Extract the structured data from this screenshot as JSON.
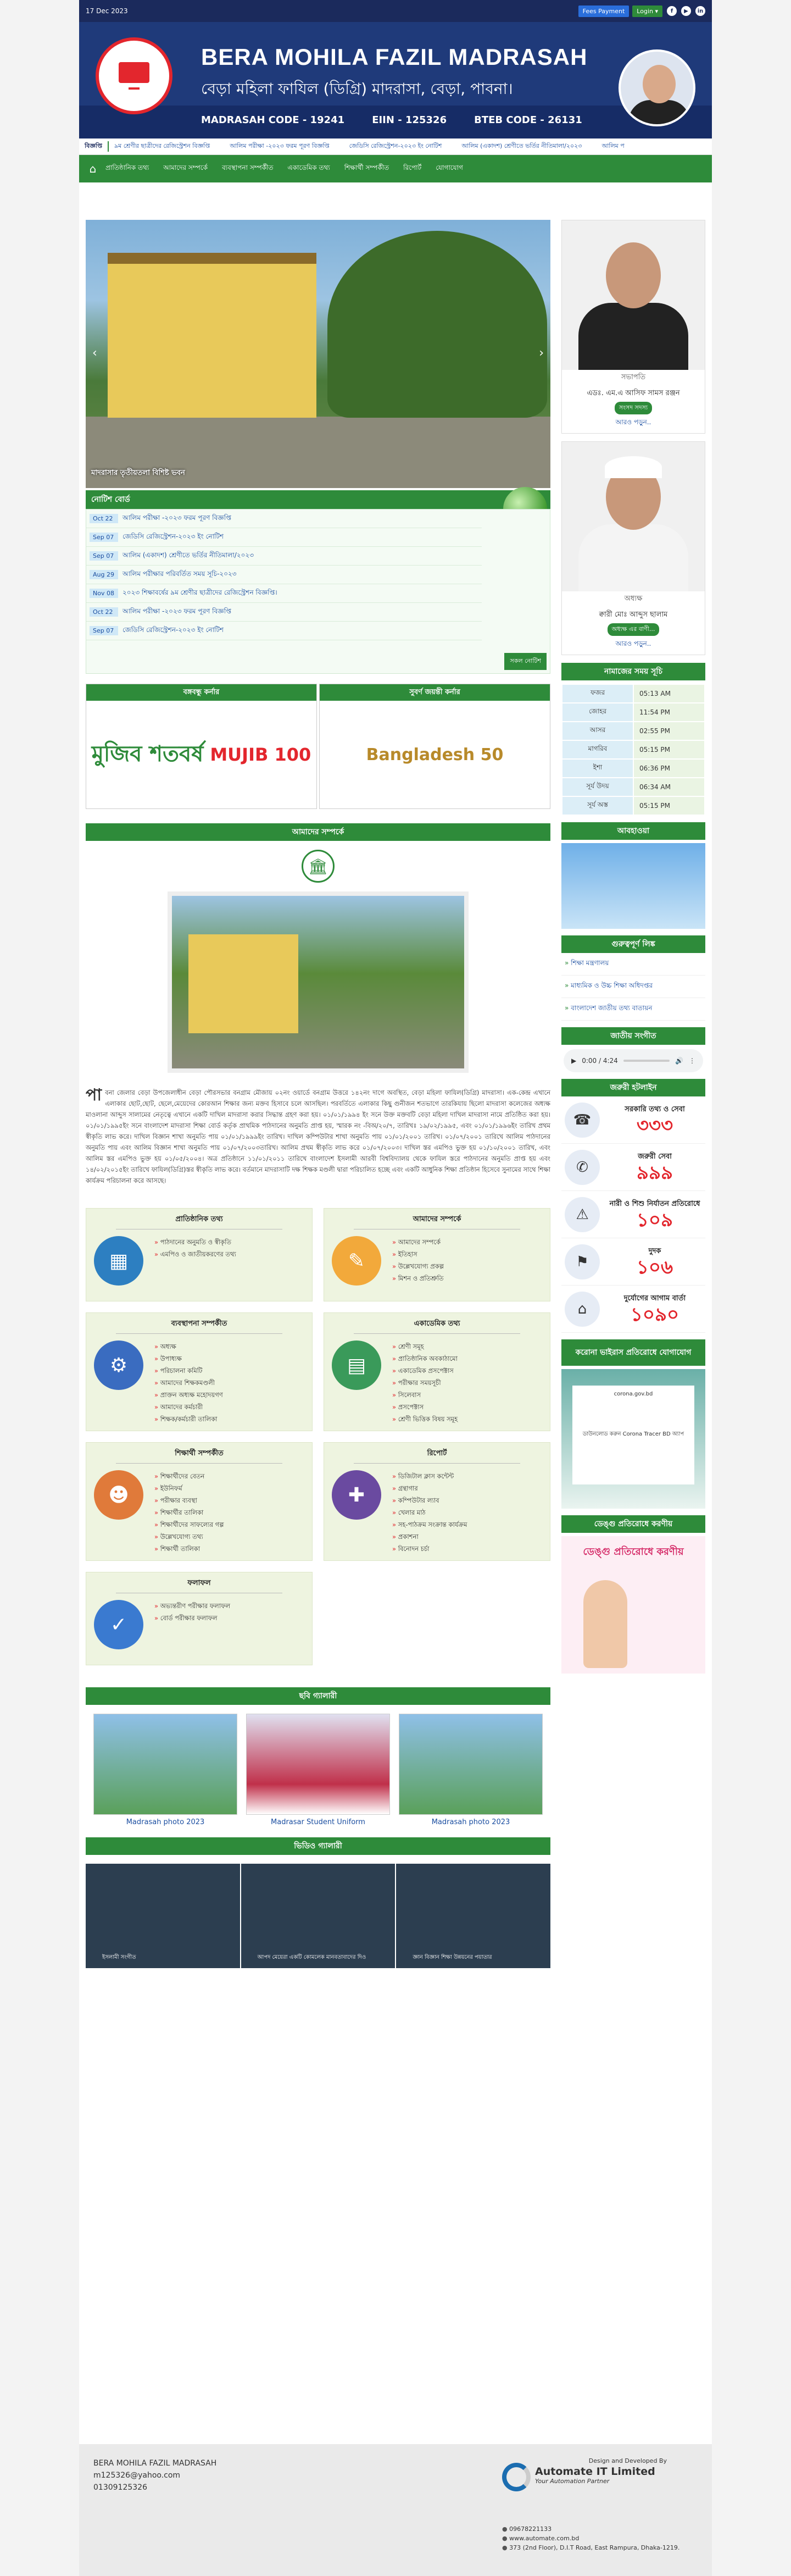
{
  "topbar": {
    "date": "17 Dec 2023",
    "fees_label": "Fees Payment",
    "login_label": "Login ▾",
    "social": [
      "f",
      "▶",
      "in"
    ]
  },
  "banner": {
    "title": "BERA MOHILA FAZIL MADRASAH",
    "subtitle": "বেড়া মহিলা ফাযিল (ডিগ্রি) মাদরাসা, বেড়া, পাবনা।",
    "code_madrasah": "MADRASAH CODE - 19241",
    "code_eiin": "EIIN - 125326",
    "code_bteb": "BTEB CODE - 26131"
  },
  "ticker": {
    "label": "বিজ্ঞপ্তি",
    "items": [
      "৯ম শ্রেণীর ছাত্রীদের রেজিস্ট্রেশন বিজ্ঞপ্তি",
      "আলিম পরীক্ষা -২০২৩ ফরম পূরণ বিজ্ঞপ্তি",
      "জেডিসি রেজিস্ট্রেশন-২০২৩ ইং নোটিশ",
      "আলিম (একাদশ) শ্রেণীতে ভর্তির নীতিমালা/২০২৩",
      "আলিম প"
    ]
  },
  "nav": {
    "items": [
      "প্রাতিষ্ঠানিক তথ্য",
      "আমাদের সম্পর্কে",
      "ব্যবস্থাপনা সম্পর্কীত",
      "একাডেমিক তথ্য",
      "শিক্ষার্থী সম্পর্কীত",
      "রিপোর্ট",
      "যোগাযোগ"
    ]
  },
  "slider": {
    "caption": "মাদরাসার তৃতীয়তলা বিশিষ্ট ভবন"
  },
  "notice": {
    "title": "নোটিশ বোর্ড",
    "all_label": "সকল নোটিশ",
    "items": [
      {
        "date": "Oct 22",
        "text": "আলিম পরীক্ষা -২০২৩ ফরম পূরণ বিজ্ঞপ্তি"
      },
      {
        "date": "Sep 07",
        "text": "জেডিসি রেজিস্ট্রেশন-২০২৩ ইং নোটিশ"
      },
      {
        "date": "Sep 07",
        "text": "আলিম (একাদশ) শ্রেণীতে ভর্তির নীতিমালা/২০২৩"
      },
      {
        "date": "Aug 29",
        "text": "আলিম পরীক্ষার পরিবর্তিত সময় সূচি-২০২৩"
      },
      {
        "date": "Nov 08",
        "text": "২০২৩ শিক্ষাবর্ষের ৯ম শ্রেণীর ছাত্রীদের রেজিস্ট্রেশন বিজ্ঞপ্তি।"
      },
      {
        "date": "Oct 22",
        "text": "আলিম পরীক্ষা -২০২৩ ফরম পূরণ বিজ্ঞপ্তি"
      },
      {
        "date": "Sep 07",
        "text": "জেডিসি রেজিস্ট্রেশন-২০২৩ ইং নোটিশ"
      }
    ]
  },
  "banners": {
    "left_title": "বঙ্গবন্ধু কর্নার",
    "right_title": "সুবর্ণ জয়ন্তী কর্নার",
    "mujib": "মুজিব শতবর্ষ",
    "mujib100": "MUJIB 100",
    "bd50": "Bangladesh 50"
  },
  "about": {
    "title": "আমাদের সম্পর্কে",
    "drop": "পা",
    "text": "বনা জেলার বেড়া উপজেলাধীন বেড়া পৌরসভার বনগ্রাম মৌজায় ০২নং ওয়ার্ডে বনগ্রাম উত্তরে ১৪২নং দাগে অবস্থিত, বেড়া মহিলা ফাযিল(ডিগ্রি) মাদরাসা। এক-কেন্দ্র এখানে এলাকার ছোট,ছোট, ছেলে,মেয়েদের কোরআন শিক্ষার জন্য মক্তব হিসাবে চলে আসছিল। পরবর্তিতে এলাকার কিছু গুনীজন শতভাগে তারকিযায় ছিলো মাদরাসা কলেজের অধ্যক্ষ মাওলানা আব্দুস সালামের নেতৃত্বে এখানে একটি দাখিল মাদরাসা করার সিদ্ধান্ত গ্রহণ করা হয়। ০১/০১/১৯৯৪ ইং সনে উক্ত মক্তবটি বেড়া মহিলা দাখিল মাদরাসা নামে প্রতিষ্ঠিত করা হয়। ০১/০১/১৯৯৫ইং সনে বাংলাদেশ মাদরাসা শিক্ষা বোর্ড কর্তৃক প্রাথমিক পাঠদানের অনুমতি প্রাপ্ত হয়, স্মারক নং -বিঅ/২০/৭, তারিখঃ ১৯/০২/১৯৯৫, এবং ০১/০১/১৯৯৬ইং তারিখ প্রথম স্বীকৃতি লাভ করে। দাখিল বিজ্ঞান শাখা অনুমতি পায় ০১/০১/১৯৯৯ইং তারিখ। দাখিল কম্পিউটার শাখা অনুমতি পায় ০১/০১/২০০১ তারিখ। ০১/০৭/২০০১ তারিখে আলিম পাঠদানের অনুমতি পায় এবং আলিম বিজ্ঞান শাখা অনুমতি পায় ০১/০৭/২০০৩তারিখ। আলিম প্রথম স্বীকৃতি লাভ করে ০১/০৭/২০০৩। দাখিল স্তর এমপিও ভুক্ত হয় ০১/১০/২০০১ তারিখ, এবং আলিম স্তর এমপিও ভুক্ত হয় ০১/০৫/২০০৪। অত্র প্রতিষ্ঠানে ১১/০১/২০১১ তারিখে বাংলাদেশ ইসলামী আরবী বিশ্ববিদ্যালয় থেকে ফাযিল স্তরে পাঠদানের অনুমতি প্রাপ্ত হয় এবং ১৪/০২/২০১৫ইং তারিখে ফাযিল(ডিগ্রি)স্তর স্বীকৃতি লাভ করে। বর্তমানে মাদরাসাটি দক্ষ শিক্ষক মণ্ডলী দ্বারা পরিচালিত হচ্ছে এবং একটি আধুনিক শিক্ষা প্রতিষ্ঠান হিসেবে সুনামের সাথে শিক্ষা কার্যক্রম পরিচালনা করে আসছে।"
  },
  "cards": [
    {
      "title": "প্রাতিষ্ঠানিক তথ্য",
      "icon": "▦",
      "color": "#2d7fc1",
      "items": [
        "পাঠদানের অনুমতি ও স্বীকৃতি",
        "এমপিও ও জাতীয়করণের তথ্য"
      ]
    },
    {
      "title": "আমাদের সম্পর্কে",
      "icon": "✎",
      "color": "#f2a93b",
      "items": [
        "আমাদের সম্পর্কে",
        "ইতিহাস",
        "উল্লেখযোগ্য প্রকল্প",
        "মিশন ও প্রতিশ্রুতি"
      ]
    },
    {
      "title": "ব্যবস্থাপনা সম্পর্কীত",
      "icon": "⚙",
      "color": "#3a6cc0",
      "items": [
        "অধ্যক্ষ",
        "উপাধ্যক্ষ",
        "পরিচালনা কমিটি",
        "আমাদের শিক্ষকমণ্ডলী",
        "প্রাক্তন অধ্যক্ষ মহোদয়গণ",
        "আমাদের কর্মচারী",
        "শিক্ষক/কর্মচারী তালিকা"
      ]
    },
    {
      "title": "একাডেমিক তথ্য",
      "icon": "▤",
      "color": "#3a9a5a",
      "items": [
        "শ্রেণী সমূহ",
        "প্রাতিষ্ঠানিক অবকাঠামো",
        "একাডেমিক প্রসপেক্টাস",
        "পরীক্ষার সময়সূচী",
        "সিলেবাস",
        "প্রসপেক্টাস",
        "শ্রেণী ভিত্তিক বিষয় সমূহ"
      ]
    },
    {
      "title": "শিক্ষার্থী সম্পর্কীত",
      "icon": "☻",
      "color": "#e07a3a",
      "items": [
        "শিক্ষার্থীদের বেতন",
        "ইউনিফর্ম",
        "পরীক্ষার ব্যবস্থা",
        "শিক্ষার্থীর তালিকা",
        "শিক্ষার্থীদের সাফল্যের গল্প",
        "উল্লেখযোগ্য তথ্য",
        "শিক্ষার্থী তালিকা"
      ]
    },
    {
      "title": "রিপোর্ট",
      "icon": "✚",
      "color": "#6a4aa0",
      "items": [
        "ডিজিটাল ক্লাস কন্টেন্ট",
        "গ্রন্থাগার",
        "কম্পিউটার ল্যাব",
        "খেলার মাঠ",
        "সহ-পাঠক্রম সংক্রান্ত কার্যক্রম",
        "প্রকাশনা",
        "বিনোদন চর্চা"
      ]
    },
    {
      "title": "ফলাফল",
      "icon": "✓",
      "color": "#3a7ad0",
      "items": [
        "অভ্যন্তরীণ পরীক্ষার ফলাফল",
        "বোর্ড পরীক্ষার ফলাফল"
      ]
    }
  ],
  "gallery": {
    "title": "ছবি গ্যালারী",
    "items": [
      "Madrasah photo 2023",
      "Madrasar Student Uniform",
      "Madrasah photo 2023"
    ]
  },
  "video": {
    "title": "ভিডিও গ্যালারী",
    "items": [
      "ইসলামী সংগীত",
      "আপদ মেয়েরা একটি কোমলেক মানবতাবাদের দিও",
      "জ্ঞান বিজ্ঞান শিক্ষা উন্নয়নের পয়াতার"
    ]
  },
  "sidebar": {
    "p1": {
      "role_tag": "সভাপতি",
      "name": "এডঃ. এম.এ আসিফ সামস রঞ্জন",
      "role": "সংসদ সদস্য",
      "more": "আরও পড়ুন.."
    },
    "p2": {
      "role_tag": "অধ্যক্ষ",
      "name": "ক্বারী মোঃ আব্দুস ছালাম",
      "role": "অধ্যক্ষ এর বাণী...",
      "more": "আরও পড়ুন.."
    },
    "prayer_title": "নামাজের সময় সূচি",
    "prayer": [
      {
        "name": "ফজর",
        "time": "05:13 AM"
      },
      {
        "name": "জোহর",
        "time": "11:54 PM"
      },
      {
        "name": "আসর",
        "time": "02:55 PM"
      },
      {
        "name": "মাগরিব",
        "time": "05:15 PM"
      },
      {
        "name": "ইশা",
        "time": "06:36 PM"
      },
      {
        "name": "সূর্য উদয়",
        "time": "06:34 AM"
      },
      {
        "name": "সূর্য অস্ত",
        "time": "05:15 PM"
      }
    ],
    "weather_title": "আবহাওয়া",
    "links_title": "গুরুত্বপূর্ণ লিঙ্ক",
    "links": [
      "শিক্ষা মন্ত্রণালয়",
      "মাধ্যমিক ও উচ্চ শিক্ষা অধিদপ্তর",
      "বাংলাদেশ জাতীয় তথ্য বাতায়ন"
    ],
    "anthem_title": "জাতীয় সংগীত",
    "audio_time": "0:00 / 4:24",
    "hotline_title": "জরুরী হটলাইন",
    "hotlines": [
      {
        "icon": "☎",
        "label": "সরকারি তথ্য ও সেবা",
        "num": "৩৩৩"
      },
      {
        "icon": "✆",
        "label": "জরুরী সেবা",
        "num": "৯৯৯"
      },
      {
        "icon": "⚠",
        "label": "নারী ও শিশু নির্যাতন প্রতিরোধে",
        "num": "১০৯"
      },
      {
        "icon": "⚑",
        "label": "দুদক",
        "num": "১০৬"
      },
      {
        "icon": "⌂",
        "label": "দুর্যোগের আগাম বার্তা",
        "num": "১০৯০"
      }
    ],
    "covid_title": "করোনা ভাইরাস প্রতিরোধে যোগাযোগ",
    "covid_text": "ডাউনলোড করুন Corona Tracer BD অ্যাপ",
    "covid_site": "corona.gov.bd",
    "dengue_title": "ডেঙ্গু প্রতিরোধে করণীয়"
  },
  "footer": {
    "name": "BERA MOHILA FAZIL MADRASAH",
    "email": "m125326@yahoo.com",
    "phone": "01309125326",
    "dev_label": "Design and Developed By",
    "dev_name": "Automate IT Limited",
    "dev_tag": "Your Automation Partner",
    "dev_phone": "09678221133",
    "dev_web": "www.automate.com.bd",
    "dev_addr": "373 (2nd Floor), D.I.T Road, East Rampura, Dhaka-1219."
  }
}
